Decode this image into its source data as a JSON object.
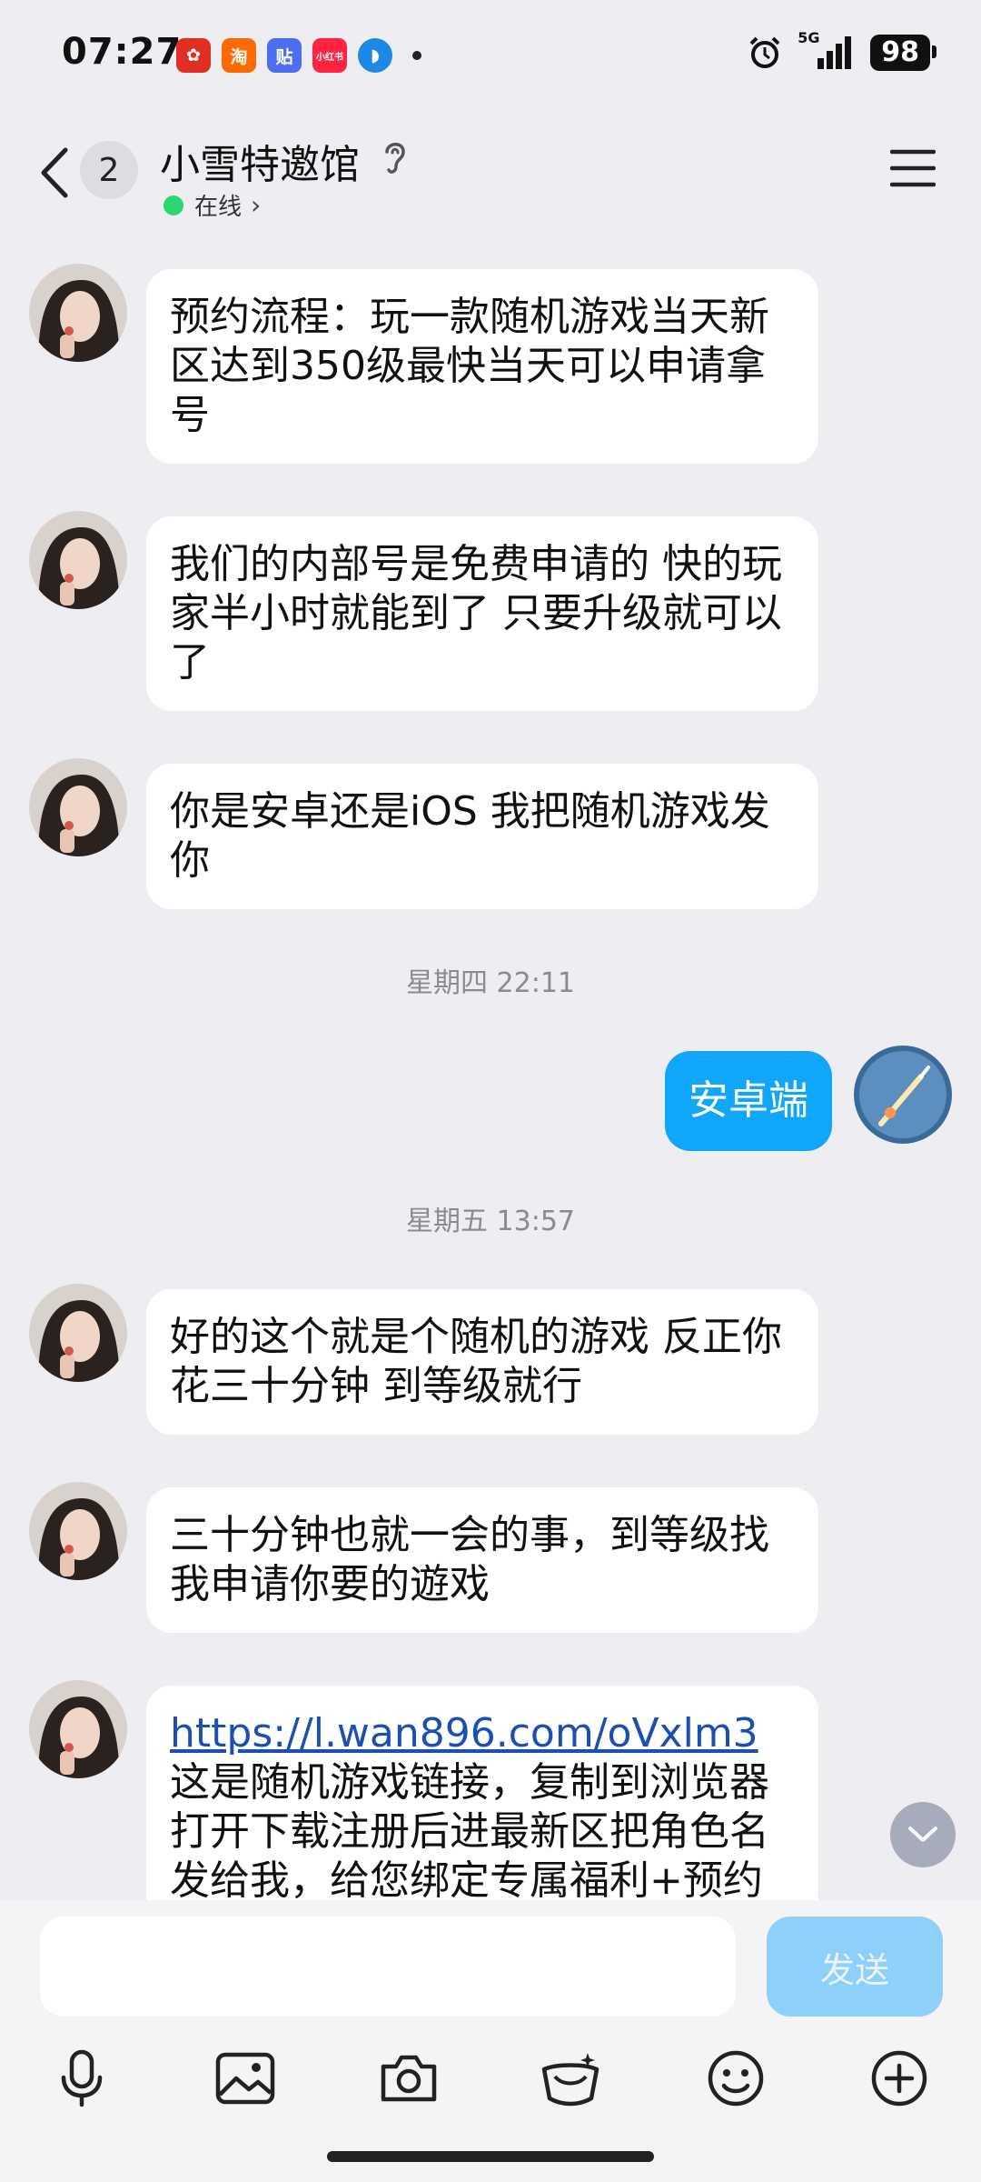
{
  "status_bar": {
    "time": "07:27",
    "app_badges": [
      "淘",
      "贴",
      "小红书"
    ],
    "network": "5G",
    "battery": "98"
  },
  "header": {
    "back_count": "2",
    "title": "小雪特邀馆",
    "status": "在线"
  },
  "messages": [
    {
      "side": "in",
      "text": "预约流程：玩一款随机游戏当天新区达到350级最快当天可以申请拿号"
    },
    {
      "side": "in",
      "text": "我们的内部号是免费申请的 快的玩家半小时就能到了 只要升级就可以了"
    },
    {
      "side": "in",
      "text": "你是安卓还是iOS 我把随机游戏发你"
    },
    {
      "timestamp": "星期四 22:11"
    },
    {
      "side": "out",
      "text": "安卓端"
    },
    {
      "timestamp": "星期五 13:57"
    },
    {
      "side": "in",
      "text": "好的这个就是个随机的游戏 反正你花三十分钟 到等级就行"
    },
    {
      "side": "in",
      "text": "三十分钟也就一会的事，到等级找我申请你要的遊戏"
    },
    {
      "side": "in",
      "link": "https://l.wan896.com/oVxlm3",
      "text": " 这是随机游戏链接，复制到浏览器打开下载注册后进最新区把角色名发给我，给您绑定专属福利+预约名"
    }
  ],
  "input": {
    "placeholder": "",
    "send_label": "发送"
  },
  "toolbar": [
    "microphone-icon",
    "image-icon",
    "camera-icon",
    "red-packet-icon",
    "emoji-icon",
    "plus-icon"
  ],
  "colors": {
    "background": "#eeeef2",
    "bubble_out": "#10a7fa",
    "online": "#2ed573",
    "link": "#1a4fb3",
    "send_disabled": "#8fd0fb"
  }
}
